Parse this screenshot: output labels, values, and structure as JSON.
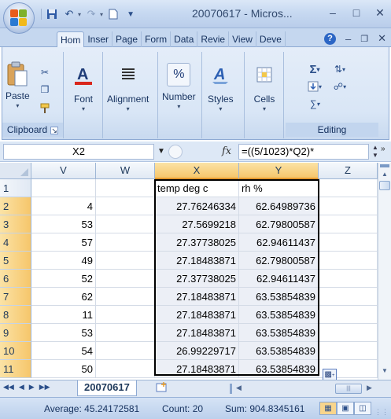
{
  "app": {
    "window_title": "20070617 - Micros...",
    "qat": {
      "save_icon": "save-icon",
      "undo_icon": "undo-icon",
      "redo_icon": "redo-icon",
      "new_icon": "new-doc-icon"
    }
  },
  "ribbon": {
    "tabs": [
      {
        "label": "Hom",
        "active": true
      },
      {
        "label": "Inser",
        "active": false
      },
      {
        "label": "Page",
        "active": false
      },
      {
        "label": "Form",
        "active": false
      },
      {
        "label": "Data",
        "active": false
      },
      {
        "label": "Revie",
        "active": false
      },
      {
        "label": "View",
        "active": false
      },
      {
        "label": "Deve",
        "active": false
      }
    ],
    "groups": {
      "clipboard": {
        "label": "Clipboard",
        "paste": "Paste"
      },
      "font": {
        "label": "Font"
      },
      "alignment": {
        "label": "Alignment"
      },
      "number": {
        "label": "Number",
        "symbol": "%"
      },
      "styles": {
        "label": "Styles"
      },
      "cells": {
        "label": "Cells"
      },
      "editing": {
        "label": "Editing"
      }
    }
  },
  "formula_bar": {
    "name_box": "X2",
    "fx_label": "fx",
    "formula": "=((5/1023)*Q2)*"
  },
  "sheet": {
    "columns": [
      "V",
      "W",
      "X",
      "Y",
      "Z"
    ],
    "selected_column_headers": [
      "X",
      "Y"
    ],
    "rows": [
      {
        "num": "1",
        "V": "",
        "W": "",
        "X": "temp deg c",
        "Y": "rh %",
        "Z": ""
      },
      {
        "num": "2",
        "V": "4",
        "W": "",
        "X": "27.76246334",
        "Y": "62.64989736",
        "Z": ""
      },
      {
        "num": "3",
        "V": "53",
        "W": "",
        "X": "27.5699218",
        "Y": "62.79800587",
        "Z": ""
      },
      {
        "num": "4",
        "V": "57",
        "W": "",
        "X": "27.37738025",
        "Y": "62.94611437",
        "Z": ""
      },
      {
        "num": "5",
        "V": "49",
        "W": "",
        "X": "27.18483871",
        "Y": "62.79800587",
        "Z": ""
      },
      {
        "num": "6",
        "V": "52",
        "W": "",
        "X": "27.37738025",
        "Y": "62.94611437",
        "Z": ""
      },
      {
        "num": "7",
        "V": "62",
        "W": "",
        "X": "27.18483871",
        "Y": "63.53854839",
        "Z": ""
      },
      {
        "num": "8",
        "V": "11",
        "W": "",
        "X": "27.18483871",
        "Y": "63.53854839",
        "Z": ""
      },
      {
        "num": "9",
        "V": "53",
        "W": "",
        "X": "27.18483871",
        "Y": "63.53854839",
        "Z": ""
      },
      {
        "num": "10",
        "V": "54",
        "W": "",
        "X": "26.99229717",
        "Y": "63.53854839",
        "Z": ""
      },
      {
        "num": "11",
        "V": "50",
        "W": "",
        "X": "27.18483871",
        "Y": "63.53854839",
        "Z": ""
      }
    ]
  },
  "sheet_tabs": {
    "active": "20070617"
  },
  "status_bar": {
    "average": "Average: 45.24172581",
    "count": "Count: 20",
    "sum": "Sum: 904.8345161"
  },
  "colors": {
    "accent": "#f6c66b",
    "ribbon": "#dbe6f6",
    "selection_fill": "#eceff6"
  }
}
